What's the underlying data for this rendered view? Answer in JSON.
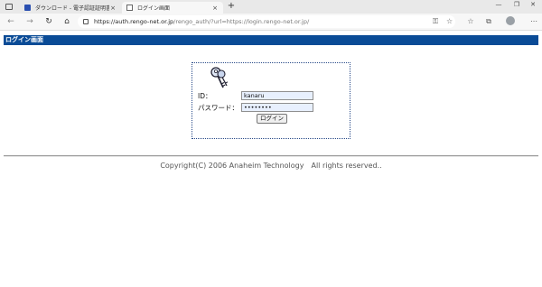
{
  "tabs": [
    {
      "title": "ダウンロード - 電子認証証明書",
      "close": "×"
    },
    {
      "title": "ログイン画面",
      "close": "×"
    }
  ],
  "new_tab": "+",
  "address_bar": {
    "url_host": "https://auth.rengo-net.or.jp",
    "url_path": "/rengo_auth/?url=https://login.rengo-net.or.jp/"
  },
  "page": {
    "header": "ログイン画面",
    "id_label": "ID：",
    "password_label": "パスワード：",
    "id_value": "kanaru",
    "password_value": "••••••••",
    "login_button": "ログイン",
    "footer": "Copyright(C) 2006 Anaheim Technology　All rights reserved.."
  },
  "icons": {
    "tab_favicon_1": "document-blue-icon",
    "tab_favicon_2": "page-icon",
    "login_icon": "keys-icon"
  },
  "colors": {
    "header_bg": "#0a4b96",
    "box_border": "#2b4c8a",
    "field_bg": "#e8f0fe"
  }
}
